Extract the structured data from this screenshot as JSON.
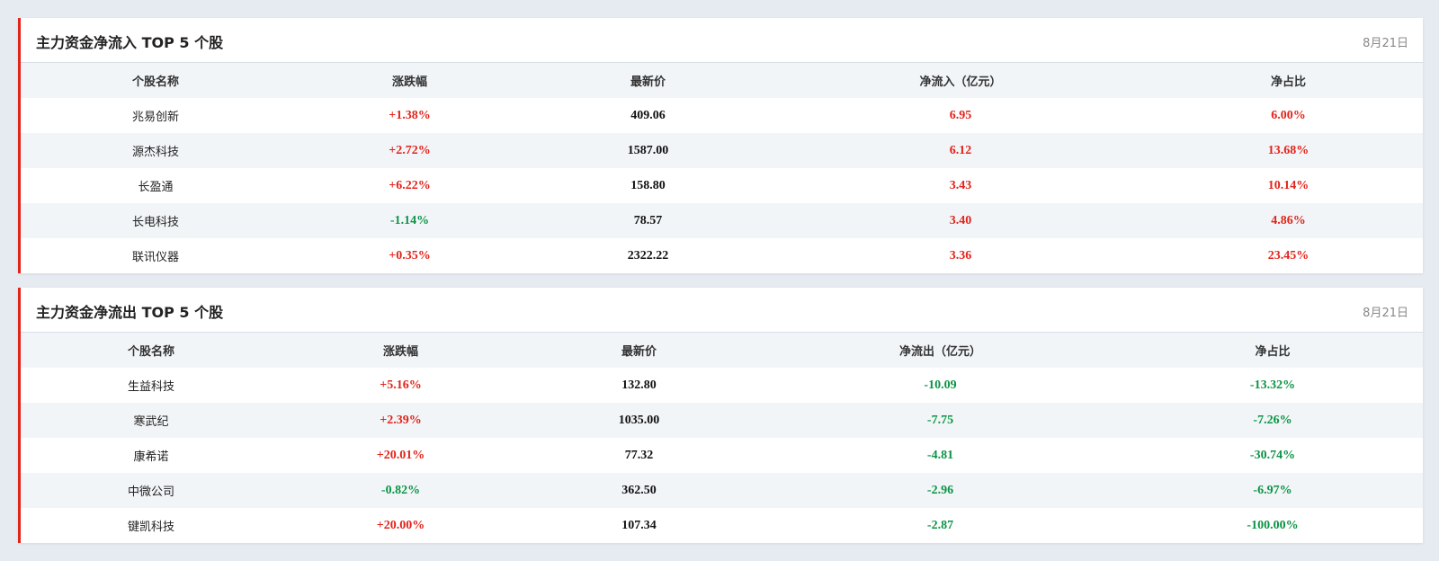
{
  "colors": {
    "accent": "#e2231a",
    "up": "#e2231a",
    "down": "#0a9444"
  },
  "inflow": {
    "title": "主力资金净流入 TOP 5 个股",
    "date": "8月21日",
    "columns": [
      "个股名称",
      "涨跌幅",
      "最新价",
      "净流入（亿元）",
      "净占比"
    ],
    "rows": [
      {
        "name": "兆易创新",
        "change": "+1.38%",
        "price": "409.06",
        "flow": "6.95",
        "ratio": "6.00%"
      },
      {
        "name": "源杰科技",
        "change": "+2.72%",
        "price": "1587.00",
        "flow": "6.12",
        "ratio": "13.68%"
      },
      {
        "name": "长盈通",
        "change": "+6.22%",
        "price": "158.80",
        "flow": "3.43",
        "ratio": "10.14%"
      },
      {
        "name": "长电科技",
        "change": "-1.14%",
        "price": "78.57",
        "flow": "3.40",
        "ratio": "4.86%"
      },
      {
        "name": "联讯仪器",
        "change": "+0.35%",
        "price": "2322.22",
        "flow": "3.36",
        "ratio": "23.45%"
      }
    ]
  },
  "outflow": {
    "title": "主力资金净流出 TOP 5 个股",
    "date": "8月21日",
    "columns": [
      "个股名称",
      "涨跌幅",
      "最新价",
      "净流出（亿元）",
      "净占比"
    ],
    "rows": [
      {
        "name": "生益科技",
        "change": "+5.16%",
        "price": "132.80",
        "flow": "-10.09",
        "ratio": "-13.32%"
      },
      {
        "name": "寒武纪",
        "change": "+2.39%",
        "price": "1035.00",
        "flow": "-7.75",
        "ratio": "-7.26%"
      },
      {
        "name": "康希诺",
        "change": "+20.01%",
        "price": "77.32",
        "flow": "-4.81",
        "ratio": "-30.74%"
      },
      {
        "name": "中微公司",
        "change": "-0.82%",
        "price": "362.50",
        "flow": "-2.96",
        "ratio": "-6.97%"
      },
      {
        "name": "键凯科技",
        "change": "+20.00%",
        "price": "107.34",
        "flow": "-2.87",
        "ratio": "-100.00%"
      }
    ]
  }
}
